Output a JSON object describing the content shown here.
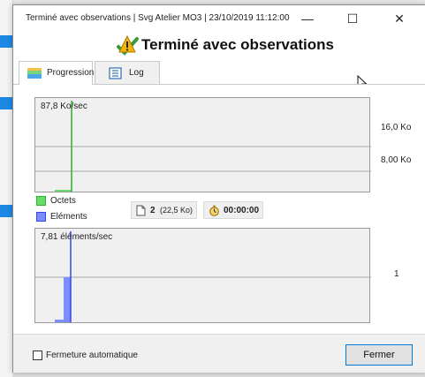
{
  "window": {
    "title": "Terminé avec observations | Svg Atelier MO3 | 23/10/2019 11:12:00",
    "minimize_glyph": "—",
    "maximize_glyph": "☐",
    "close_glyph": "✕"
  },
  "header": {
    "title": "Terminé avec observations",
    "icon": "warning-icon"
  },
  "tabs": [
    {
      "label": "Progression",
      "icon": "progress-icon",
      "active": true
    },
    {
      "label": "Log",
      "icon": "log-icon",
      "active": false
    }
  ],
  "graph_top": {
    "rate_label": "87,8 Ko/sec",
    "axis_labels": [
      "16,0 Ko",
      "8,00 Ko"
    ]
  },
  "legend": {
    "octets": {
      "label": "Octets",
      "color": "#66dd66"
    },
    "elements": {
      "label": "Eléments",
      "color": "#7d8cff"
    }
  },
  "summary": {
    "file_count": "2",
    "file_size": "(22,5 Ko)",
    "elapsed": "00:00:00"
  },
  "graph_bottom": {
    "rate_label": "7,81 éléments/sec",
    "axis_labels": [
      "1"
    ]
  },
  "footer": {
    "auto_close_label": "Fermeture automatique",
    "auto_close_checked": false,
    "close_button_label": "Fermer"
  },
  "colors": {
    "octets_line": "#2fae2f",
    "elements_line": "#3344ff",
    "button_border": "#0078d7"
  }
}
